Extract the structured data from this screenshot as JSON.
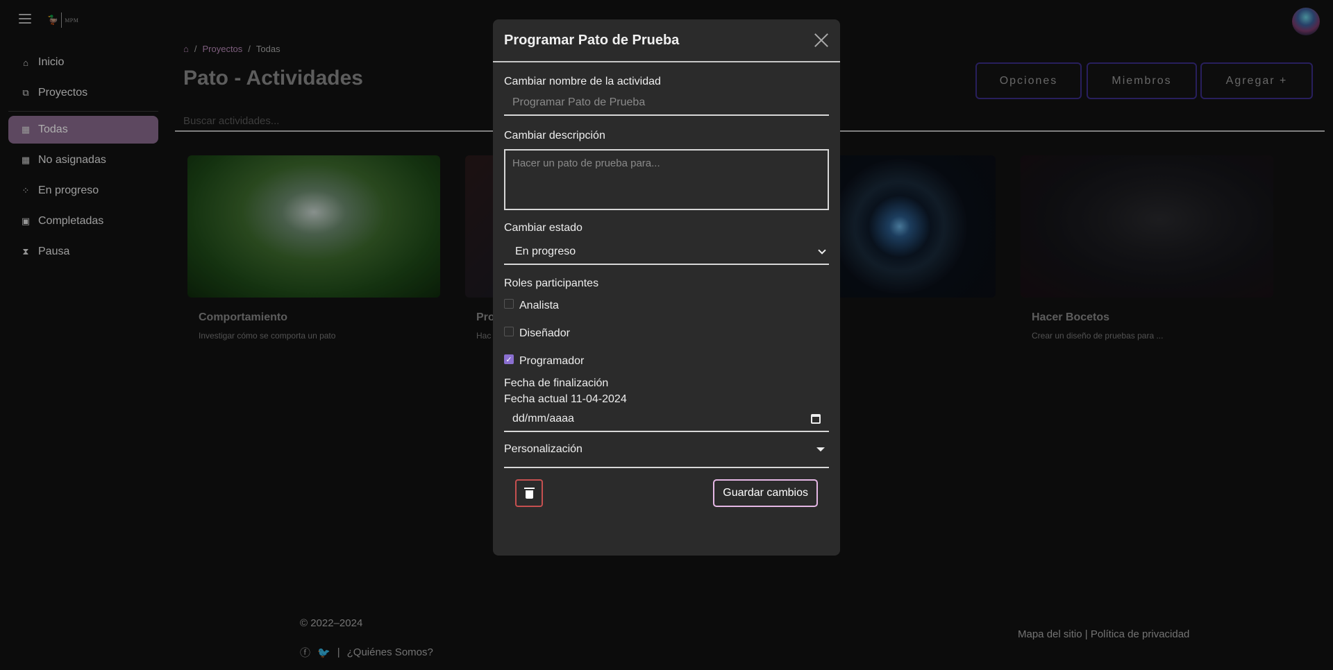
{
  "header": {
    "logo_text": "MPM",
    "menu_icon": "hamburger-menu-icon",
    "avatar_icon": "user-avatar"
  },
  "sidebar": {
    "items": [
      {
        "label": "Inicio",
        "icon": "home-icon"
      },
      {
        "label": "Proyectos",
        "icon": "project-diagram-icon"
      },
      {
        "label": "Todas",
        "icon": "grid-icon",
        "active": true
      },
      {
        "label": "No asignadas",
        "icon": "grid-outline-icon"
      },
      {
        "label": "En progreso",
        "icon": "spinner-icon"
      },
      {
        "label": "Completadas",
        "icon": "calendar-check-icon"
      },
      {
        "label": "Pausa",
        "icon": "hourglass-icon"
      }
    ]
  },
  "breadcrumb": {
    "items": [
      "Proyectos",
      "Todas"
    ]
  },
  "main": {
    "title": "Pato - Actividades",
    "search_placeholder": "Buscar actividades...",
    "buttons": {
      "options": "Opciones",
      "members": "Miembros",
      "add": "Agregar +"
    },
    "accent_color": "#3b2f8a",
    "cards": [
      {
        "title": "Comportamiento",
        "desc": "Investigar cómo se comporta un pato"
      },
      {
        "title": "Pro",
        "desc": "Hac"
      },
      {
        "title": "",
        "desc": ""
      },
      {
        "title": "Hacer Bocetos",
        "desc": "Crear un diseño de pruebas para ..."
      }
    ]
  },
  "modal": {
    "title": "Programar Pato de Prueba",
    "name_label": "Cambiar nombre de la actividad",
    "name_placeholder": "Programar Pato de Prueba",
    "desc_label": "Cambiar descripción",
    "desc_placeholder": "Hacer un pato de prueba para...",
    "status_label": "Cambiar estado",
    "status_value": "En progreso",
    "roles_label": "Roles participantes",
    "roles": [
      {
        "label": "Analista",
        "checked": false
      },
      {
        "label": "Diseñador",
        "checked": false
      },
      {
        "label": "Programador",
        "checked": true
      }
    ],
    "end_date_label": "Fecha de finalización",
    "current_date_text": "Fecha actual 11-04-2024",
    "date_placeholder": "dd/mm/aaaa",
    "customization_label": "Personalización",
    "save_label": "Guardar cambios",
    "checkbox_color": "#8a6fd0",
    "delete_border_color": "#c65050"
  },
  "footer": {
    "copyright": "© 2022–2024",
    "about": "¿Quiénes Somos?",
    "sitemap": "Mapa del sitio",
    "privacy": "Política de privacidad",
    "separator": "|"
  }
}
